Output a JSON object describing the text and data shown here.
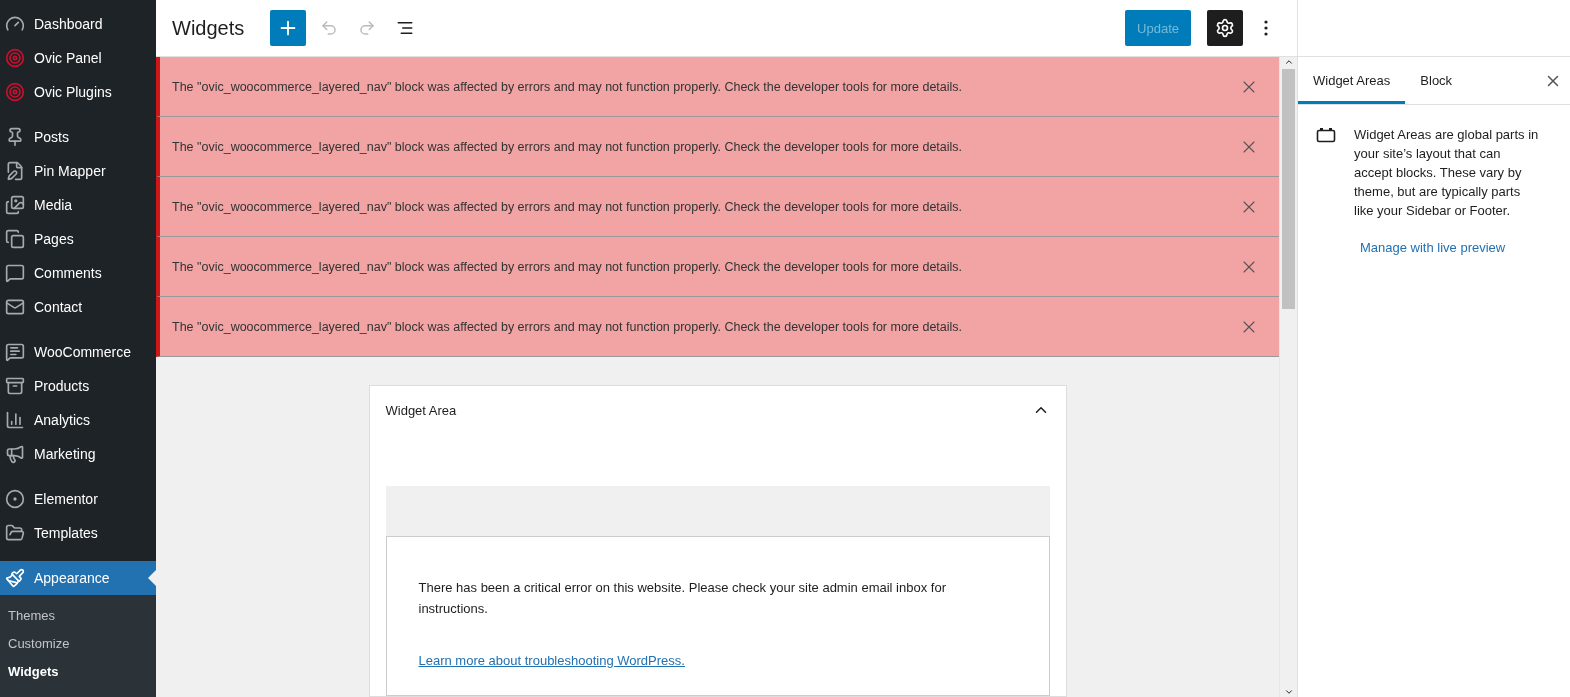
{
  "sidebar": {
    "groups": [
      [
        {
          "label": "Dashboard",
          "selected": false
        },
        {
          "label": "Ovic Panel",
          "selected": false
        },
        {
          "label": "Ovic Plugins",
          "selected": false
        }
      ],
      [
        {
          "label": "Posts",
          "selected": false
        },
        {
          "label": "Pin Mapper",
          "selected": false
        },
        {
          "label": "Media",
          "selected": false
        },
        {
          "label": "Pages",
          "selected": false
        },
        {
          "label": "Comments",
          "selected": false
        },
        {
          "label": "Contact",
          "selected": false
        }
      ],
      [
        {
          "label": "WooCommerce",
          "selected": false
        },
        {
          "label": "Products",
          "selected": false
        },
        {
          "label": "Analytics",
          "selected": false
        },
        {
          "label": "Marketing",
          "selected": false
        }
      ],
      [
        {
          "label": "Elementor",
          "selected": false
        },
        {
          "label": "Templates",
          "selected": false
        }
      ],
      [
        {
          "label": "Appearance",
          "selected": true
        }
      ]
    ],
    "submenu": [
      {
        "label": "Themes",
        "selected": false
      },
      {
        "label": "Customize",
        "selected": false
      },
      {
        "label": "Widgets",
        "selected": true
      }
    ]
  },
  "header": {
    "title": "Widgets",
    "undo": {
      "disabled": true
    },
    "redo": {
      "disabled": true
    },
    "update_button": {
      "label": "Update",
      "disabled": true
    },
    "settings": {
      "pressed": true
    }
  },
  "notices": [
    {
      "message": "The \"ovic_woocommerce_layered_nav\" block was affected by errors and may not function properly. Check the developer tools for more details."
    },
    {
      "message": "The \"ovic_woocommerce_layered_nav\" block was affected by errors and may not function properly. Check the developer tools for more details."
    },
    {
      "message": "The \"ovic_woocommerce_layered_nav\" block was affected by errors and may not function properly. Check the developer tools for more details."
    },
    {
      "message": "The \"ovic_woocommerce_layered_nav\" block was affected by errors and may not function properly. Check the developer tools for more details."
    },
    {
      "message": "The \"ovic_woocommerce_layered_nav\" block was affected by errors and may not function properly. Check the developer tools for more details."
    }
  ],
  "widget_area": {
    "title": "Widget Area",
    "expanded": true,
    "error": "There has been a critical error on this website. Please check your site admin email inbox for instructions.",
    "link": "Learn more about troubleshooting WordPress."
  },
  "panel": {
    "tabs": [
      {
        "label": "Widget Areas",
        "selected": true
      },
      {
        "label": "Block",
        "selected": false
      }
    ],
    "description": "Widget Areas are global parts in your site’s layout that can accept blocks. These vary by theme, but are typically parts like your Sidebar or Footer.",
    "link": "Manage with live preview"
  }
}
